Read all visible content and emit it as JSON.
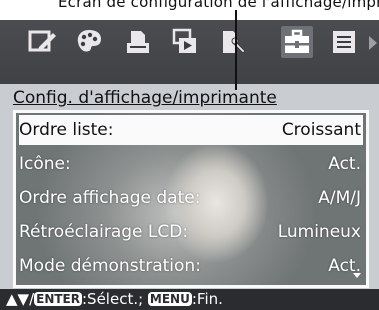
{
  "annotation": {
    "text": "Écran de configuration de l'affichage/imprimante"
  },
  "toolbar": {
    "icons": [
      "edit-icon",
      "palette-icon",
      "print-icon",
      "slideshow-icon",
      "print-setting-icon",
      "toolbox-icon",
      "list-icon"
    ],
    "selected": "toolbox-icon"
  },
  "panel": {
    "title": "Config. d'affichage/imprimante",
    "rows": [
      {
        "label": "Ordre liste:",
        "value": "Croissant"
      },
      {
        "label": "Icône:",
        "value": "Act."
      },
      {
        "label": "Ordre affichage date:",
        "value": "A/M/J"
      },
      {
        "label": "Rétroéclairage LCD:",
        "value": "Lumineux"
      },
      {
        "label": "Mode démonstration:",
        "value": "Act."
      }
    ],
    "selected_row": 0
  },
  "footer": {
    "arrows": "▲▼/",
    "enter_key": "ENTER",
    "select_text": ":Sélect.; ",
    "menu_key": "MENU",
    "end_text": ":Fin."
  },
  "colors": {
    "screen": "#2e3033",
    "panel": "#c9cdd1",
    "selected_row": "#fafafa",
    "icon": "#e9e7e9"
  }
}
